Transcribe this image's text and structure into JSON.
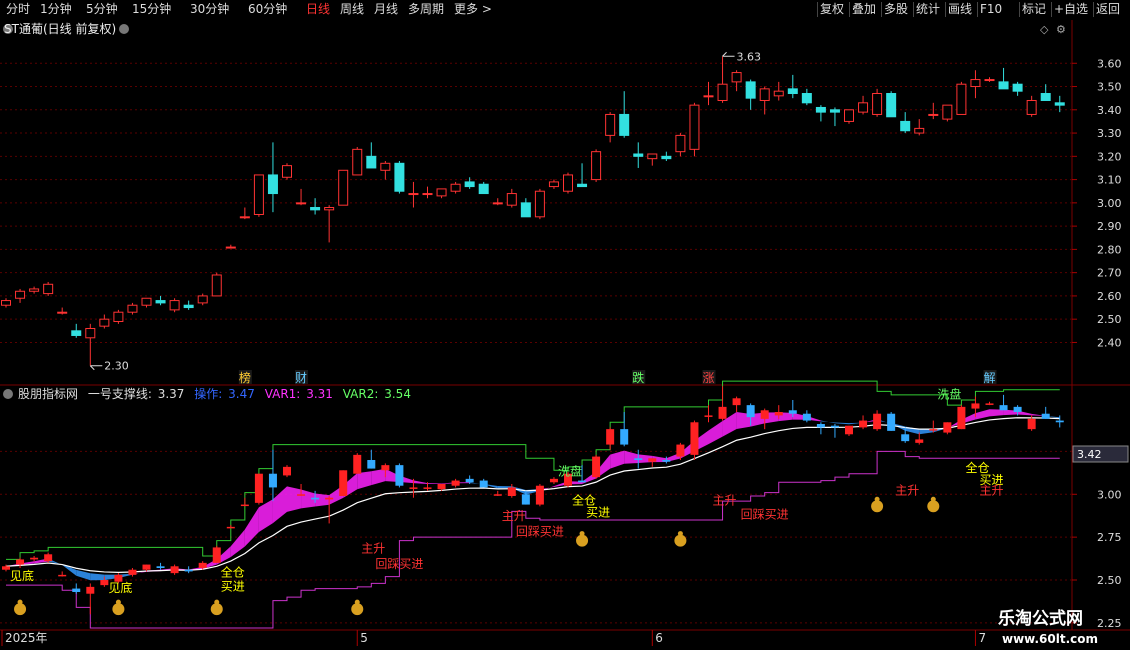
{
  "toolbar": {
    "left": [
      "分时",
      "1分钟",
      "5分钟",
      "15分钟",
      "30分钟",
      "60分钟",
      "日线",
      "周线",
      "月线",
      "多周期",
      "更多 >"
    ],
    "active": "日线",
    "right": [
      "复权",
      "叠加",
      "多股",
      "统计",
      "画线",
      "F10",
      "标记",
      "+自选",
      "返回"
    ]
  },
  "main_panel": {
    "title": "ST通葡(日线 前复权)",
    "high_label": "3.63",
    "low_label": "2.30",
    "event_tags": [
      {
        "label": "榜",
        "color": "#ffcc33",
        "index": 17
      },
      {
        "label": "财",
        "color": "#66ccff",
        "index": 21
      },
      {
        "label": "跌",
        "color": "#66ff66",
        "index": 45
      },
      {
        "label": "涨",
        "color": "#ff4444",
        "index": 50
      },
      {
        "label": "解",
        "color": "#66ccff",
        "index": 70
      }
    ]
  },
  "indicator_panel": {
    "name": "股朋指标网",
    "support_label": "一号支撑线:",
    "support_value": "3.37",
    "op_label": "操作:",
    "op_value": "3.47",
    "var1_label": "VAR1:",
    "var1_value": "3.31",
    "var2_label": "VAR2:",
    "var2_value": "3.54",
    "current_price": "3.42",
    "axis_ticks": [
      "3.25",
      "3.00",
      "2.75",
      "2.50",
      "2.25"
    ],
    "signals": [
      {
        "text": "见底",
        "color": "#ffff00",
        "idx": 1,
        "price": 2.5
      },
      {
        "text": "见底",
        "color": "#ffff00",
        "idx": 8,
        "price": 2.43
      },
      {
        "text": "全仓",
        "color": "#ffff00",
        "idx": 16,
        "price": 2.52
      },
      {
        "text": "买进",
        "color": "#ffff00",
        "idx": 16,
        "price": 2.44
      },
      {
        "text": "主升",
        "color": "#ff3333",
        "idx": 26,
        "price": 2.66
      },
      {
        "text": "回踩买进",
        "color": "#ff3333",
        "idx": 27,
        "price": 2.57
      },
      {
        "text": "主升",
        "color": "#ff3333",
        "idx": 36,
        "price": 2.85
      },
      {
        "text": "回踩买进",
        "color": "#ff3333",
        "idx": 37,
        "price": 2.76
      },
      {
        "text": "洗盘",
        "color": "#66ff66",
        "idx": 40,
        "price": 3.11
      },
      {
        "text": "全仓",
        "color": "#ffff00",
        "idx": 41,
        "price": 2.94
      },
      {
        "text": "买进",
        "color": "#ffff00",
        "idx": 42,
        "price": 2.87
      },
      {
        "text": "主升",
        "color": "#ff3333",
        "idx": 51,
        "price": 2.94
      },
      {
        "text": "回踩买进",
        "color": "#ff3333",
        "idx": 53,
        "price": 2.86
      },
      {
        "text": "洗盘",
        "color": "#66ff66",
        "idx": 67,
        "price": 3.56
      },
      {
        "text": "全仓",
        "color": "#ffff00",
        "idx": 69,
        "price": 3.13
      },
      {
        "text": "主升",
        "color": "#ff3333",
        "idx": 64,
        "price": 3.0
      },
      {
        "text": "买进",
        "color": "#ffff00",
        "idx": 70,
        "price": 3.06
      },
      {
        "text": "主升",
        "color": "#ff3333",
        "idx": 70,
        "price": 3.0
      }
    ]
  },
  "time_axis": [
    {
      "label": "2025年",
      "index": 0
    },
    {
      "label": "5",
      "index": 25
    },
    {
      "label": "6",
      "index": 46
    },
    {
      "label": "7",
      "index": 69
    }
  ],
  "watermark": {
    "line1": "乐淘公式网",
    "line2": "www.60lt.com"
  },
  "chart_data": {
    "type": "candlestick",
    "title": "ST通葡(日线 前复权)",
    "ylim": [
      2.23,
      3.7
    ],
    "y_ticks": [
      "3.60",
      "3.50",
      "3.40",
      "3.30",
      "3.20",
      "3.10",
      "3.00",
      "2.90",
      "2.80",
      "2.70",
      "2.60",
      "2.50",
      "2.40"
    ],
    "candles": [
      {
        "o": 2.56,
        "h": 2.59,
        "l": 2.55,
        "c": 2.58
      },
      {
        "o": 2.59,
        "h": 2.63,
        "l": 2.57,
        "c": 2.62
      },
      {
        "o": 2.62,
        "h": 2.64,
        "l": 2.61,
        "c": 2.63
      },
      {
        "o": 2.61,
        "h": 2.66,
        "l": 2.6,
        "c": 2.65
      },
      {
        "o": 2.53,
        "h": 2.55,
        "l": 2.52,
        "c": 2.53
      },
      {
        "o": 2.45,
        "h": 2.48,
        "l": 2.42,
        "c": 2.43
      },
      {
        "o": 2.42,
        "h": 2.48,
        "l": 2.3,
        "c": 2.46
      },
      {
        "o": 2.47,
        "h": 2.52,
        "l": 2.46,
        "c": 2.5
      },
      {
        "o": 2.49,
        "h": 2.54,
        "l": 2.48,
        "c": 2.53
      },
      {
        "o": 2.53,
        "h": 2.57,
        "l": 2.52,
        "c": 2.56
      },
      {
        "o": 2.56,
        "h": 2.59,
        "l": 2.55,
        "c": 2.59
      },
      {
        "o": 2.58,
        "h": 2.6,
        "l": 2.56,
        "c": 2.57
      },
      {
        "o": 2.54,
        "h": 2.59,
        "l": 2.53,
        "c": 2.58
      },
      {
        "o": 2.56,
        "h": 2.58,
        "l": 2.54,
        "c": 2.55
      },
      {
        "o": 2.57,
        "h": 2.61,
        "l": 2.56,
        "c": 2.6
      },
      {
        "o": 2.6,
        "h": 2.7,
        "l": 2.6,
        "c": 2.69
      },
      {
        "o": 2.81,
        "h": 2.82,
        "l": 2.81,
        "c": 2.81
      },
      {
        "o": 2.94,
        "h": 2.98,
        "l": 2.93,
        "c": 2.94
      },
      {
        "o": 2.95,
        "h": 3.12,
        "l": 2.94,
        "c": 3.12
      },
      {
        "o": 3.12,
        "h": 3.26,
        "l": 2.96,
        "c": 3.04
      },
      {
        "o": 3.11,
        "h": 3.17,
        "l": 3.1,
        "c": 3.16
      },
      {
        "o": 3.0,
        "h": 3.06,
        "l": 2.99,
        "c": 3.0
      },
      {
        "o": 2.98,
        "h": 3.02,
        "l": 2.95,
        "c": 2.97
      },
      {
        "o": 2.97,
        "h": 2.99,
        "l": 2.83,
        "c": 2.98
      },
      {
        "o": 2.99,
        "h": 3.14,
        "l": 2.99,
        "c": 3.14
      },
      {
        "o": 3.12,
        "h": 3.24,
        "l": 3.12,
        "c": 3.23
      },
      {
        "o": 3.2,
        "h": 3.26,
        "l": 3.15,
        "c": 3.15
      },
      {
        "o": 3.14,
        "h": 3.18,
        "l": 3.1,
        "c": 3.17
      },
      {
        "o": 3.17,
        "h": 3.18,
        "l": 3.04,
        "c": 3.05
      },
      {
        "o": 3.04,
        "h": 3.09,
        "l": 2.98,
        "c": 3.04
      },
      {
        "o": 3.04,
        "h": 3.07,
        "l": 3.02,
        "c": 3.04
      },
      {
        "o": 3.03,
        "h": 3.06,
        "l": 3.02,
        "c": 3.06
      },
      {
        "o": 3.05,
        "h": 3.09,
        "l": 3.04,
        "c": 3.08
      },
      {
        "o": 3.09,
        "h": 3.11,
        "l": 3.06,
        "c": 3.07
      },
      {
        "o": 3.08,
        "h": 3.09,
        "l": 3.04,
        "c": 3.04
      },
      {
        "o": 3.0,
        "h": 3.02,
        "l": 2.99,
        "c": 3.0
      },
      {
        "o": 2.99,
        "h": 3.06,
        "l": 2.98,
        "c": 3.04
      },
      {
        "o": 3.0,
        "h": 3.02,
        "l": 2.94,
        "c": 2.94
      },
      {
        "o": 2.94,
        "h": 3.06,
        "l": 2.93,
        "c": 3.05
      },
      {
        "o": 3.07,
        "h": 3.1,
        "l": 3.06,
        "c": 3.09
      },
      {
        "o": 3.05,
        "h": 3.13,
        "l": 3.04,
        "c": 3.12
      },
      {
        "o": 3.08,
        "h": 3.17,
        "l": 3.07,
        "c": 3.07
      },
      {
        "o": 3.1,
        "h": 3.23,
        "l": 3.09,
        "c": 3.22
      },
      {
        "o": 3.29,
        "h": 3.39,
        "l": 3.26,
        "c": 3.38
      },
      {
        "o": 3.38,
        "h": 3.48,
        "l": 3.28,
        "c": 3.29
      },
      {
        "o": 3.21,
        "h": 3.26,
        "l": 3.15,
        "c": 3.2
      },
      {
        "o": 3.19,
        "h": 3.21,
        "l": 3.16,
        "c": 3.21
      },
      {
        "o": 3.2,
        "h": 3.22,
        "l": 3.18,
        "c": 3.19
      },
      {
        "o": 3.22,
        "h": 3.3,
        "l": 3.2,
        "c": 3.29
      },
      {
        "o": 3.23,
        "h": 3.43,
        "l": 3.2,
        "c": 3.42
      },
      {
        "o": 3.46,
        "h": 3.52,
        "l": 3.42,
        "c": 3.46
      },
      {
        "o": 3.44,
        "h": 3.63,
        "l": 3.43,
        "c": 3.51
      },
      {
        "o": 3.52,
        "h": 3.57,
        "l": 3.48,
        "c": 3.56
      },
      {
        "o": 3.52,
        "h": 3.53,
        "l": 3.4,
        "c": 3.45
      },
      {
        "o": 3.44,
        "h": 3.5,
        "l": 3.38,
        "c": 3.49
      },
      {
        "o": 3.46,
        "h": 3.52,
        "l": 3.44,
        "c": 3.48
      },
      {
        "o": 3.49,
        "h": 3.55,
        "l": 3.45,
        "c": 3.47
      },
      {
        "o": 3.47,
        "h": 3.49,
        "l": 3.42,
        "c": 3.43
      },
      {
        "o": 3.41,
        "h": 3.42,
        "l": 3.35,
        "c": 3.39
      },
      {
        "o": 3.4,
        "h": 3.41,
        "l": 3.33,
        "c": 3.39
      },
      {
        "o": 3.35,
        "h": 3.4,
        "l": 3.34,
        "c": 3.4
      },
      {
        "o": 3.39,
        "h": 3.46,
        "l": 3.38,
        "c": 3.43
      },
      {
        "o": 3.38,
        "h": 3.49,
        "l": 3.37,
        "c": 3.47
      },
      {
        "o": 3.47,
        "h": 3.48,
        "l": 3.37,
        "c": 3.37
      },
      {
        "o": 3.35,
        "h": 3.39,
        "l": 3.3,
        "c": 3.31
      },
      {
        "o": 3.3,
        "h": 3.36,
        "l": 3.29,
        "c": 3.32
      },
      {
        "o": 3.38,
        "h": 3.43,
        "l": 3.36,
        "c": 3.38
      },
      {
        "o": 3.36,
        "h": 3.42,
        "l": 3.35,
        "c": 3.42
      },
      {
        "o": 3.38,
        "h": 3.52,
        "l": 3.38,
        "c": 3.51
      },
      {
        "o": 3.5,
        "h": 3.57,
        "l": 3.45,
        "c": 3.53
      },
      {
        "o": 3.53,
        "h": 3.54,
        "l": 3.52,
        "c": 3.53
      },
      {
        "o": 3.52,
        "h": 3.58,
        "l": 3.5,
        "c": 3.49
      },
      {
        "o": 3.51,
        "h": 3.52,
        "l": 3.46,
        "c": 3.48
      },
      {
        "o": 3.38,
        "h": 3.46,
        "l": 3.37,
        "c": 3.44
      },
      {
        "o": 3.47,
        "h": 3.51,
        "l": 3.44,
        "c": 3.44
      },
      {
        "o": 3.43,
        "h": 3.46,
        "l": 3.39,
        "c": 3.42
      }
    ]
  }
}
